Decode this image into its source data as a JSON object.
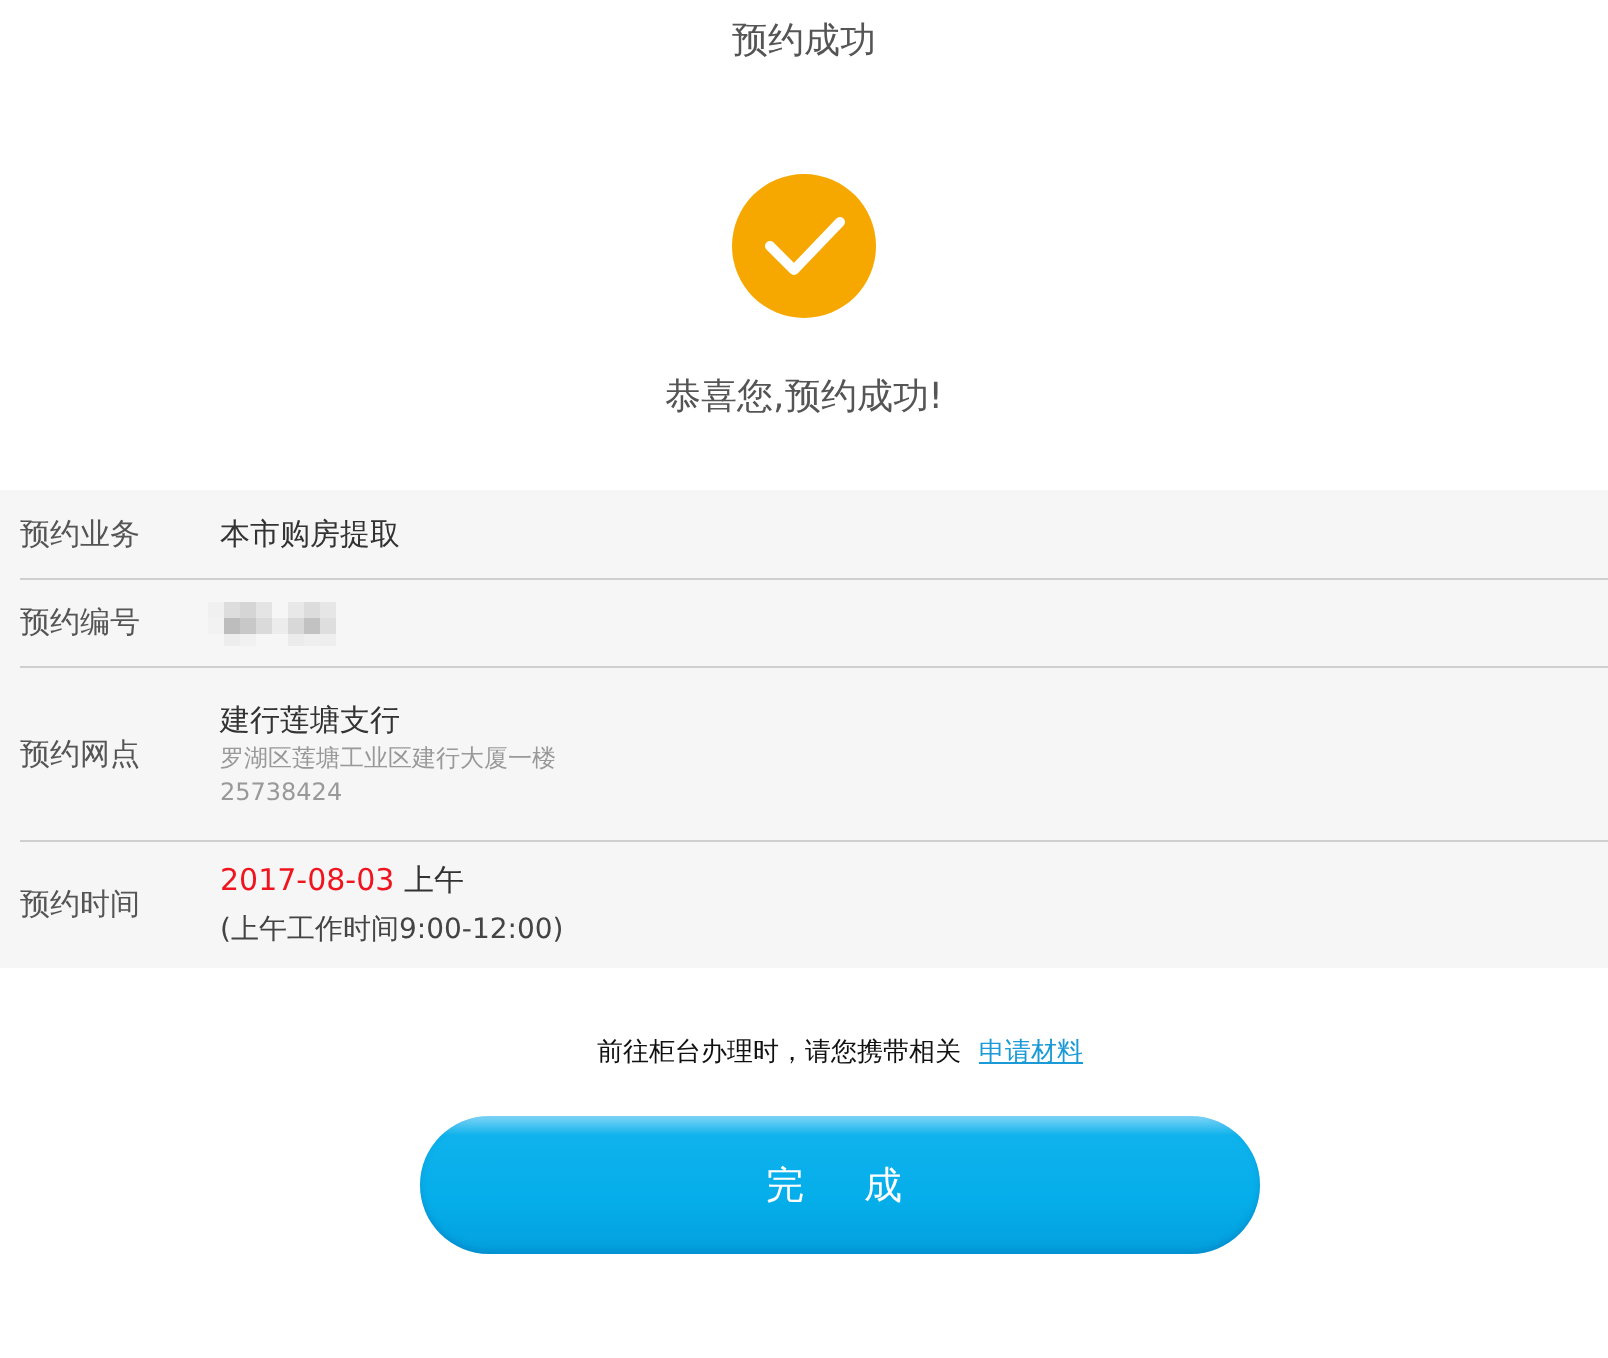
{
  "header": {
    "title": "预约成功"
  },
  "result": {
    "message": "恭喜您,预约成功!"
  },
  "details": [
    {
      "kind": "text",
      "label": "预约业务",
      "value": "本市购房提取"
    },
    {
      "kind": "hidden",
      "label": "预约编号"
    },
    {
      "kind": "branch",
      "label": "预约网点",
      "value": "建行莲塘支行",
      "address": "罗湖区莲塘工业区建行大厦一楼",
      "phone": "25738424"
    },
    {
      "kind": "time",
      "label": "预约时间",
      "date": "2017-08-03",
      "period": "上午",
      "hours": "(上午工作时间9:00-12:00)"
    }
  ],
  "notice": {
    "text": "前往柜台办理时，请您携带相关",
    "link": "申请材料"
  },
  "button": {
    "label": "完成"
  }
}
